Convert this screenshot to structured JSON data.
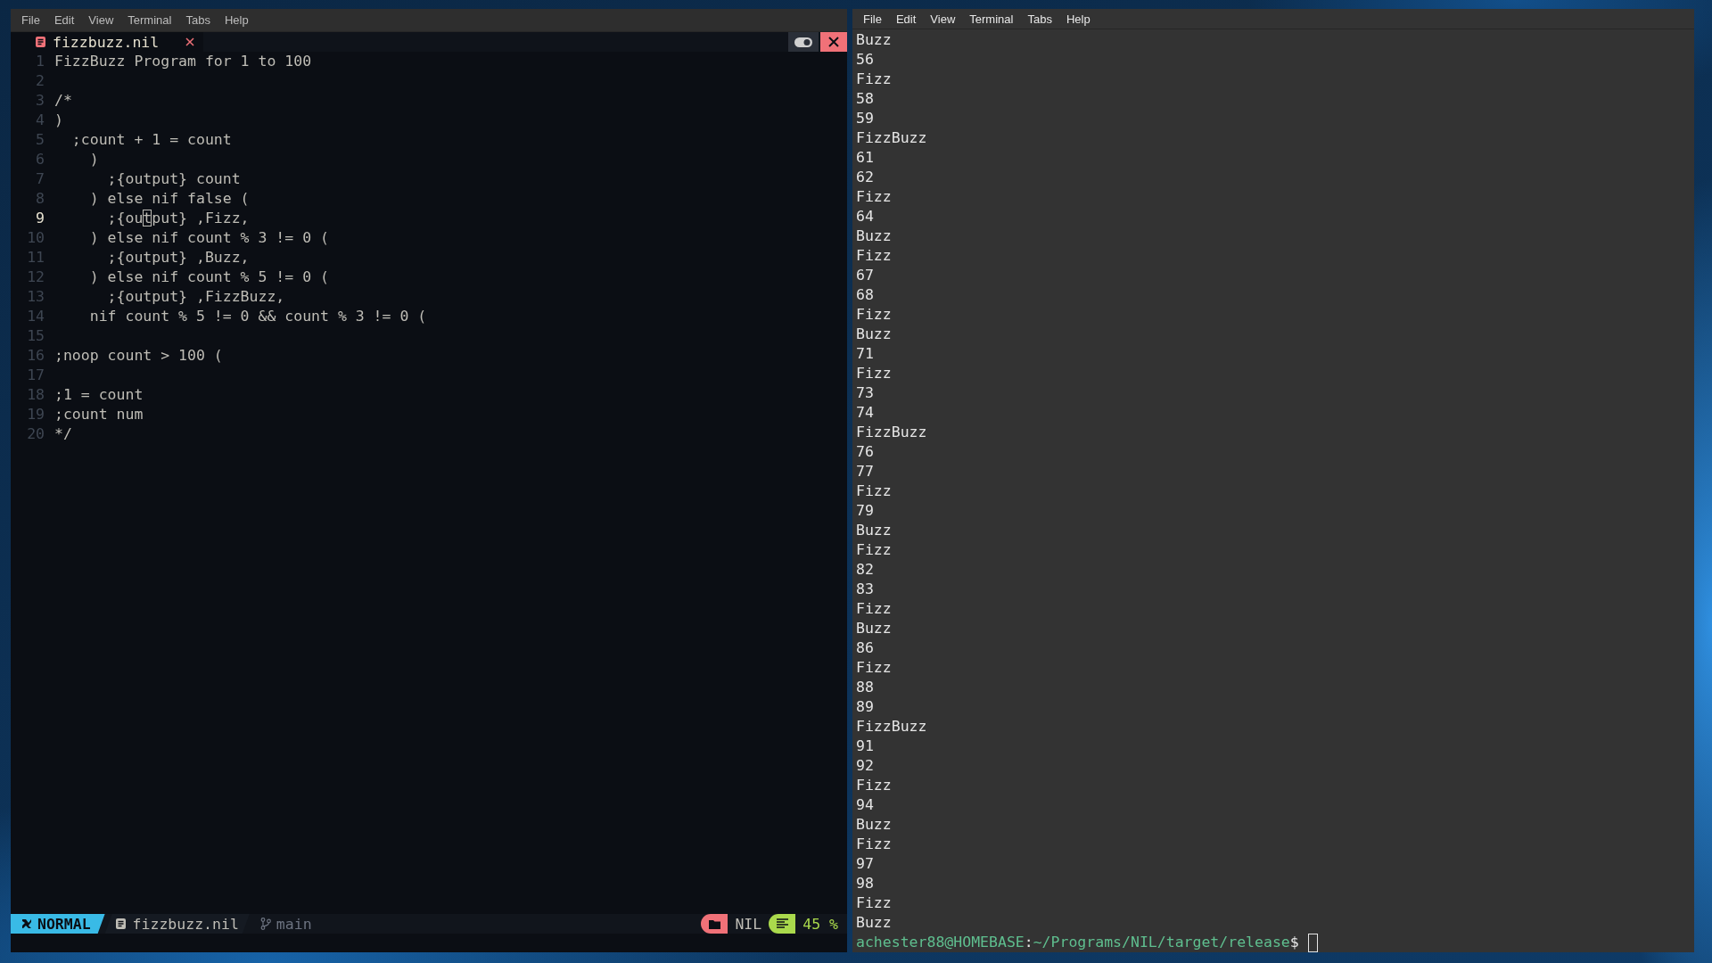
{
  "editor": {
    "menu": [
      "File",
      "Edit",
      "View",
      "Terminal",
      "Tabs",
      "Help"
    ],
    "tab": {
      "label": "fizzbuzz.nil",
      "selected": true
    },
    "lines": [
      {
        "number": "1",
        "text": "FizzBuzz Program for 1 to 100",
        "current": false
      },
      {
        "number": "2",
        "current": false
      },
      {
        "number": "3",
        "text": "/*",
        "current": false
      },
      {
        "number": "4",
        "text": ")",
        "current": false
      },
      {
        "number": "5",
        "text": "  ;count + 1 = count",
        "current": false
      },
      {
        "number": "6",
        "text": "    )",
        "current": false
      },
      {
        "number": "7",
        "text": "      ;{output} count",
        "current": false
      },
      {
        "number": "8",
        "text": "    ) else nif false (",
        "current": false
      },
      {
        "number": "9",
        "text": "      ;{ou",
        "cursor": "t",
        "rest": "put} ,Fizz,",
        "current": true
      },
      {
        "number": "10",
        "text": "    ) else nif count % 3 != 0 (",
        "current": false
      },
      {
        "number": "11",
        "text": "      ;{output} ,Buzz,",
        "current": false
      },
      {
        "number": "12",
        "text": "    ) else nif count % 5 != 0 (",
        "current": false
      },
      {
        "number": "13",
        "text": "      ;{output} ,FizzBuzz,",
        "current": false
      },
      {
        "number": "14",
        "text": "    nif count % 5 != 0 && count % 3 != 0 (",
        "current": false
      },
      {
        "number": "15",
        "current": false
      },
      {
        "number": "16",
        "text": ";noop count > 100 (",
        "current": false
      },
      {
        "number": "17",
        "current": false
      },
      {
        "number": "18",
        "text": ";1 = count",
        "current": false
      },
      {
        "number": "19",
        "text": ";count num",
        "current": false
      },
      {
        "number": "20",
        "text": "*/",
        "current": false
      }
    ],
    "status": {
      "mode": "NORMAL",
      "file": "fizzbuzz.nil",
      "branch": "main",
      "filetype": "NIL",
      "percent": "45 %"
    }
  },
  "terminal": {
    "menu": [
      "File",
      "Edit",
      "View",
      "Terminal",
      "Tabs",
      "Help"
    ],
    "output": [
      "Buzz",
      "56",
      "Fizz",
      "58",
      "59",
      "FizzBuzz",
      "61",
      "62",
      "Fizz",
      "64",
      "Buzz",
      "Fizz",
      "67",
      "68",
      "Fizz",
      "Buzz",
      "71",
      "Fizz",
      "73",
      "74",
      "FizzBuzz",
      "76",
      "77",
      "Fizz",
      "79",
      "Buzz",
      "Fizz",
      "82",
      "83",
      "Fizz",
      "Buzz",
      "86",
      "Fizz",
      "88",
      "89",
      "FizzBuzz",
      "91",
      "92",
      "Fizz",
      "94",
      "Buzz",
      "Fizz",
      "97",
      "98",
      "Fizz",
      "Buzz"
    ],
    "prompt": {
      "user_host": "achester88@HOMEBASE",
      "separator": ":",
      "path": "~/Programs/NIL/target/release",
      "symbol": "$"
    }
  }
}
